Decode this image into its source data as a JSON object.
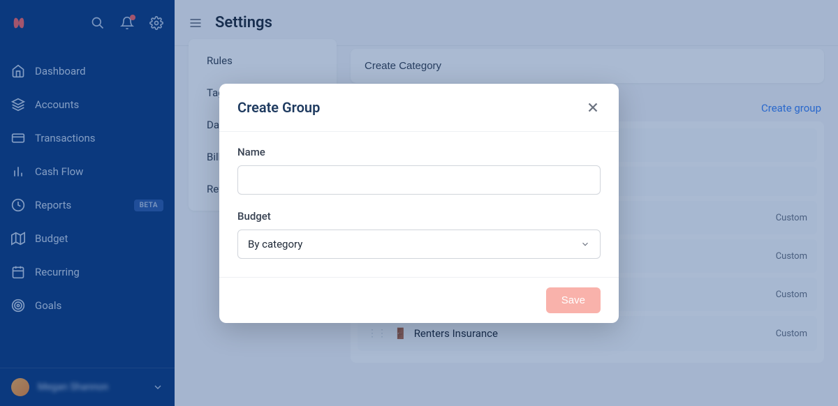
{
  "header": {
    "page_title": "Settings"
  },
  "sidebar": {
    "nav": [
      {
        "label": "Dashboard",
        "icon": "home-icon"
      },
      {
        "label": "Accounts",
        "icon": "layers-icon"
      },
      {
        "label": "Transactions",
        "icon": "card-icon"
      },
      {
        "label": "Cash Flow",
        "icon": "bars-icon"
      },
      {
        "label": "Reports",
        "icon": "clock-icon",
        "badge": "BETA"
      },
      {
        "label": "Budget",
        "icon": "map-icon"
      },
      {
        "label": "Recurring",
        "icon": "calendar-icon"
      },
      {
        "label": "Goals",
        "icon": "target-icon"
      }
    ],
    "user_name": "Megan Shannon"
  },
  "settings_tabs": [
    "Rules",
    "Tags",
    "Data",
    "Billing",
    "Referrals"
  ],
  "settings_main": {
    "create_category_label": "Create Category",
    "create_group_label": "Create group",
    "categories": [
      {
        "emoji": "",
        "label": "",
        "custom": ""
      },
      {
        "emoji": "",
        "label": "",
        "custom": ""
      },
      {
        "emoji": "",
        "label": "",
        "custom": "Custom"
      },
      {
        "emoji": "",
        "label": "",
        "custom": "Custom"
      },
      {
        "emoji": "",
        "label": "",
        "custom": "Custom"
      },
      {
        "emoji": "🚪",
        "label": "Renters Insurance",
        "custom": "Custom"
      }
    ]
  },
  "modal": {
    "title": "Create Group",
    "name_label": "Name",
    "name_value": "",
    "budget_label": "Budget",
    "budget_value": "By category",
    "save_label": "Save"
  }
}
